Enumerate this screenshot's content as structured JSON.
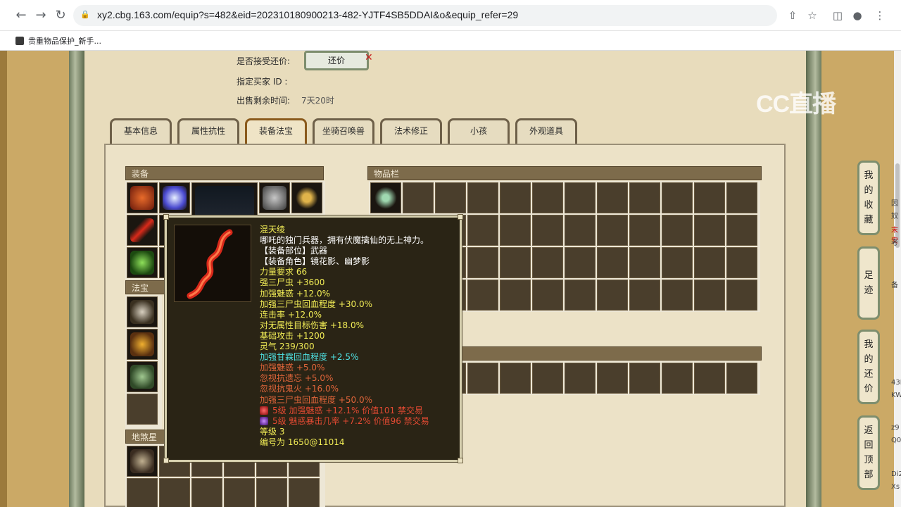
{
  "browser": {
    "url": "xy2.cbg.163.com/equip?s=482&eid=202310180900213-482-YJTF4SB5DDAI&o&equip_refer=29",
    "bookmark_label": "贵重物品保护_新手..."
  },
  "watermark": "CC直播",
  "sale_info": {
    "accept_counter_label": "是否接受还价:",
    "counter_button": "还价",
    "buyer_id_label": "指定买家 ID :",
    "time_left_label": "出售剩余时间:",
    "time_left_value": "7天20时"
  },
  "tabs": [
    {
      "label": "基本信息"
    },
    {
      "label": "属性抗性"
    },
    {
      "label": "装备法宝"
    },
    {
      "label": "坐骑召唤兽"
    },
    {
      "label": "法术修正"
    },
    {
      "label": "小孩"
    },
    {
      "label": "外观道具"
    }
  ],
  "active_tab": "装备法宝",
  "sections": {
    "equipment": "装备",
    "fabao": "法宝",
    "inventory": "物品栏",
    "dishax": "地煞星阵"
  },
  "tooltip": {
    "name": "混天绫",
    "lines": [
      {
        "text": "哪吒的独门兵器，拥有伏魔擒仙的无上神力。",
        "color": "white"
      },
      {
        "text": "【装备部位】武器",
        "color": "white"
      },
      {
        "text": "【装备角色】镜花影、幽梦影",
        "color": "white"
      },
      {
        "text": "力量要求 66",
        "color": "yellow"
      },
      {
        "text": "强三尸虫 +3600",
        "color": "yellow"
      },
      {
        "text": "加强魅惑 +12.0%",
        "color": "yellow"
      },
      {
        "text": "加强三尸虫回血程度 +30.0%",
        "color": "yellow"
      },
      {
        "text": "连击率 +12.0%",
        "color": "yellow"
      },
      {
        "text": "对无属性目标伤害 +18.0%",
        "color": "yellow"
      },
      {
        "text": "基础攻击 +1200",
        "color": "yellow"
      },
      {
        "text": "灵气 239/300",
        "color": "yellow"
      },
      {
        "text": "加强甘霖回血程度 +2.5%",
        "color": "cyan"
      },
      {
        "text": "加强魅惑 +5.0%",
        "color": "orange"
      },
      {
        "text": "忽视抗遗忘 +5.0%",
        "color": "orange"
      },
      {
        "text": "忽视抗鬼火 +16.0%",
        "color": "orange"
      },
      {
        "text": "加强三尸虫回血程度 +50.0%",
        "color": "orange"
      }
    ],
    "gems": [
      {
        "text": "5级 加强魅惑 +12.1% 价值101 禁交易",
        "icon": "red-gem-icon"
      },
      {
        "text": "5级 魅惑暴击几率 +7.2% 价值96 禁交易",
        "icon": "purple-gem-icon"
      }
    ],
    "level": "等级 3",
    "serial": "编号为 1650@11014"
  },
  "side_nav": [
    {
      "label": "我的收藏",
      "chars": [
        "我",
        "的",
        "收",
        "藏"
      ]
    },
    {
      "label": "足迹",
      "chars": [
        "足",
        "迹"
      ]
    },
    {
      "label": "我的还价",
      "chars": [
        "我",
        "的",
        "还",
        "价"
      ]
    },
    {
      "label": "返回顶部",
      "chars": [
        "返",
        "回",
        "顶",
        "部"
      ]
    }
  ],
  "right_ghost": [
    "因",
    "奴",
    "末安",
    "考",
    "备",
    "43I",
    "KW",
    "z9",
    "Q0",
    "Di2",
    "Xs"
  ],
  "colors": {
    "page_bg": "#cba966",
    "content_bg": "#e8dcbc",
    "tooltip_bg": "#2a2415",
    "name_yellow": "#f2ed56",
    "cyan": "#4fe1e3",
    "orange": "#e0653a"
  }
}
